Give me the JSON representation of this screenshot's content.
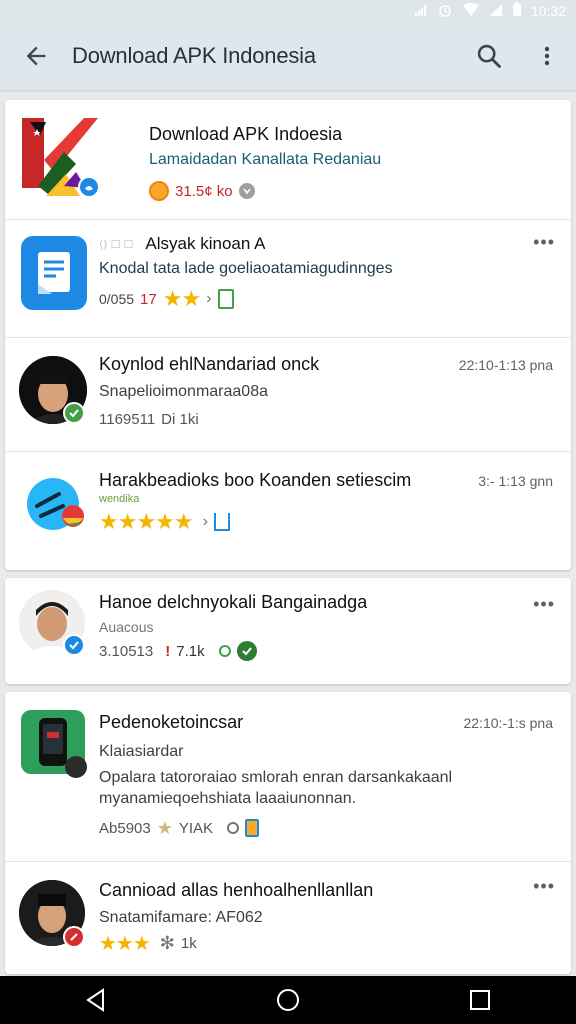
{
  "status_bar": {
    "time": "10:32"
  },
  "app_bar": {
    "title": "Download APK Indonesia",
    "icons": [
      "back-arrow-icon",
      "search-icon",
      "more-vert-icon"
    ]
  },
  "items": [
    {
      "title": "Download APK Indoesia",
      "subtitle": "Lamaidadan Kanallata Redaniau",
      "rating": "31.5¢ ko"
    },
    {
      "faint": "⟨⟩ ☐ ☐",
      "title": "Alsyak kinoan A",
      "subtitle": "Knodal tata lade goeliaoatamiagudinnges",
      "code": "0/055",
      "rating": "17"
    },
    {
      "title": "Koynlod ehlNandariad onck",
      "time": "22:10-1:13 pna",
      "subtitle": "Snapelioimonmaraa08a",
      "meta": "1169511",
      "meta2": "Di 1ki"
    },
    {
      "title": "Harakbeadioks boo Koanden setiescim",
      "time": "3:- 1:13 gnn",
      "tag": "wendika"
    },
    {
      "title": "Hanoe delchnyokali Bangainadga",
      "subtitle": "Auacous",
      "code": "3.10513",
      "rating": "7.1k"
    },
    {
      "title": "Pedenoketoincsar",
      "time": "22:10:-1:s pna",
      "subtitle": "Klaiasiardar",
      "description": "Opalara tatororaiao smlorah enran darsankakaanl myanamieqoehshiata laaaiunonnan.",
      "code": "Ab5903",
      "rating": "YIAK"
    },
    {
      "title": "Cannioad allas henhoalhenllanllan",
      "subtitle": "Snatamifamare: AF062",
      "rating": "1k"
    }
  ],
  "colors": {
    "accent_blue": "#1e88e5",
    "accent_green": "#2e7d32",
    "star": "#f5b400",
    "rating_red": "#c62828"
  }
}
